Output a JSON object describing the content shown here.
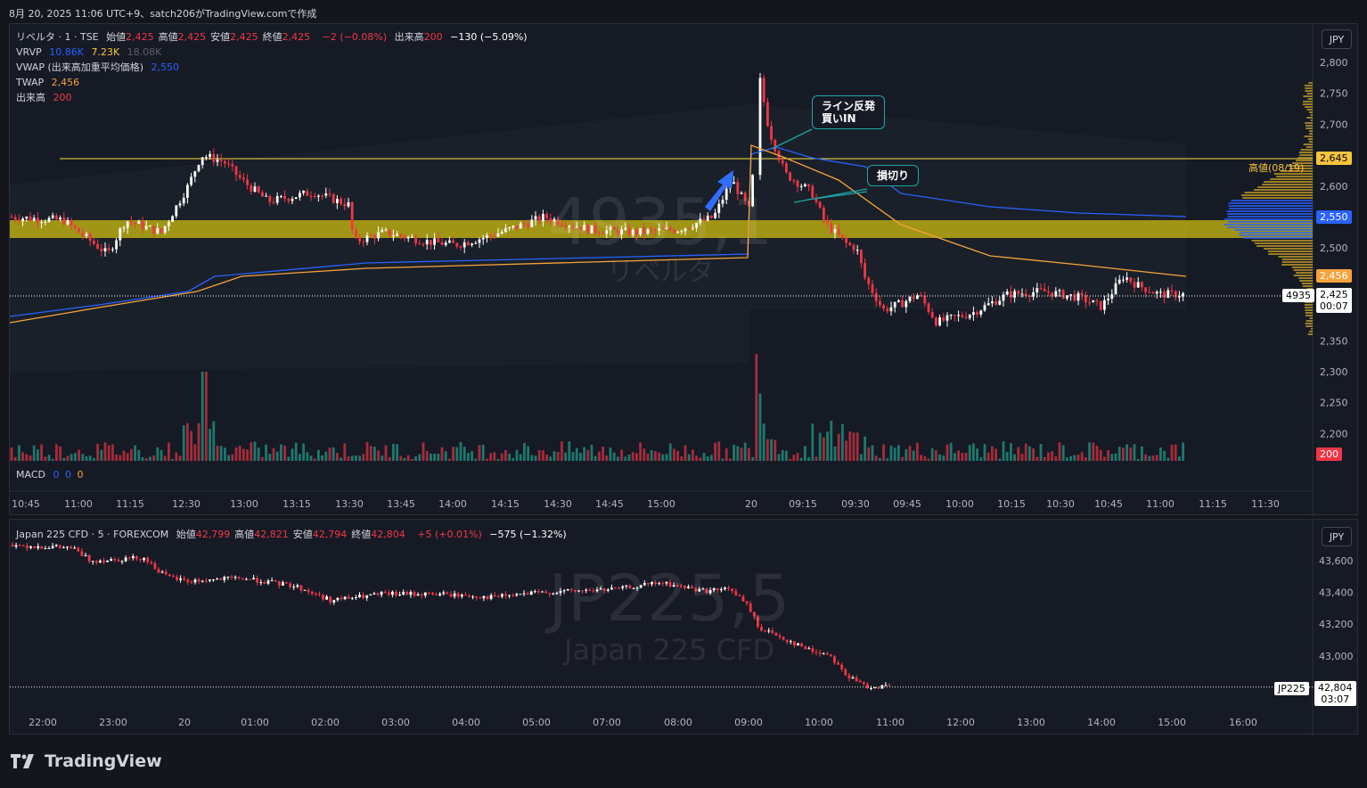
{
  "header": {
    "text": "8月 20, 2025 11:06 UTC+9、satch206がTradingView.comで作成"
  },
  "pane1": {
    "symbol": "リベルタ · 1 · TSE",
    "ohlc": [
      {
        "label": "始値",
        "value": "2,425"
      },
      {
        "label": "高値",
        "value": "2,425"
      },
      {
        "label": "安値",
        "value": "2,425"
      },
      {
        "label": "終値",
        "value": "2,425"
      }
    ],
    "change": "−2 (−0.08%)",
    "volume_label": "出来高",
    "volume_value": "200",
    "volume_change": "−130 (−5.09%)",
    "indicators": {
      "vrvp": {
        "name": "VRVP",
        "v1": "10.86K",
        "v2": "7.23K",
        "v3": "18.08K"
      },
      "vwap": {
        "name": "VWAP (出来高加重平均価格)",
        "value": "2,550"
      },
      "twap": {
        "name": "TWAP",
        "value": "2,456"
      },
      "vol": {
        "name": "出来高",
        "value": "200"
      },
      "macd": {
        "name": "MACD",
        "v1": "0",
        "v2": "0",
        "v3": "0"
      }
    },
    "currency": "JPY",
    "watermark": {
      "ticker": "4935,1",
      "name": "リベルタ"
    },
    "price_ticks": [
      "2,800",
      "2,750",
      "2,700",
      "2,600",
      "2,500",
      "2,350",
      "2,300",
      "2,250",
      "2,200"
    ],
    "price_labels": {
      "high": "2,645",
      "high_text": "高値(08/19)",
      "vwap": "2,550",
      "twap": "2,456",
      "last": "2,425",
      "countdown": "00:07",
      "ticker_tag": "4935",
      "vol": "200"
    },
    "time_ticks": [
      "10:45",
      "11:00",
      "11:15",
      "12:30",
      "13:00",
      "13:15",
      "13:30",
      "13:45",
      "14:00",
      "14:15",
      "14:30",
      "14:45",
      "15:00",
      "20",
      "09:15",
      "09:30",
      "09:45",
      "10:00",
      "10:15",
      "10:30",
      "10:45",
      "11:00",
      "11:15",
      "11:30"
    ],
    "notes": [
      {
        "text": "ライン反発\n買いIN"
      },
      {
        "text": "損切り"
      }
    ],
    "colors": {
      "up": "#ffffff",
      "down": "#f23645",
      "vwap": "#2962ff",
      "twap": "#f7a33c",
      "band": "#d4c20d",
      "note": "#1da5a7"
    }
  },
  "pane2": {
    "symbol": "Japan 225 CFD · 5 · FOREXCOM",
    "ohlc": [
      {
        "label": "始値",
        "value": "42,799"
      },
      {
        "label": "高値",
        "value": "42,821"
      },
      {
        "label": "安値",
        "value": "42,794"
      },
      {
        "label": "終値",
        "value": "42,804"
      }
    ],
    "change": "+5 (+0.01%)",
    "change2": "−575 (−1.32%)",
    "currency": "JPY",
    "watermark": {
      "ticker": "JP225,5",
      "name": "Japan 225 CFD"
    },
    "price_ticks": [
      "43,600",
      "43,400",
      "43,200",
      "43,000"
    ],
    "price_labels": {
      "last": "42,804",
      "countdown": "03:07",
      "ticker_tag": "JP225"
    },
    "time_ticks": [
      "22:00",
      "23:00",
      "20",
      "01:00",
      "02:00",
      "03:00",
      "04:00",
      "05:00",
      "07:00",
      "08:00",
      "09:00",
      "10:00",
      "11:00",
      "12:00",
      "13:00",
      "14:00",
      "15:00",
      "16:00"
    ]
  },
  "footer": {
    "brand": "TradingView"
  }
}
